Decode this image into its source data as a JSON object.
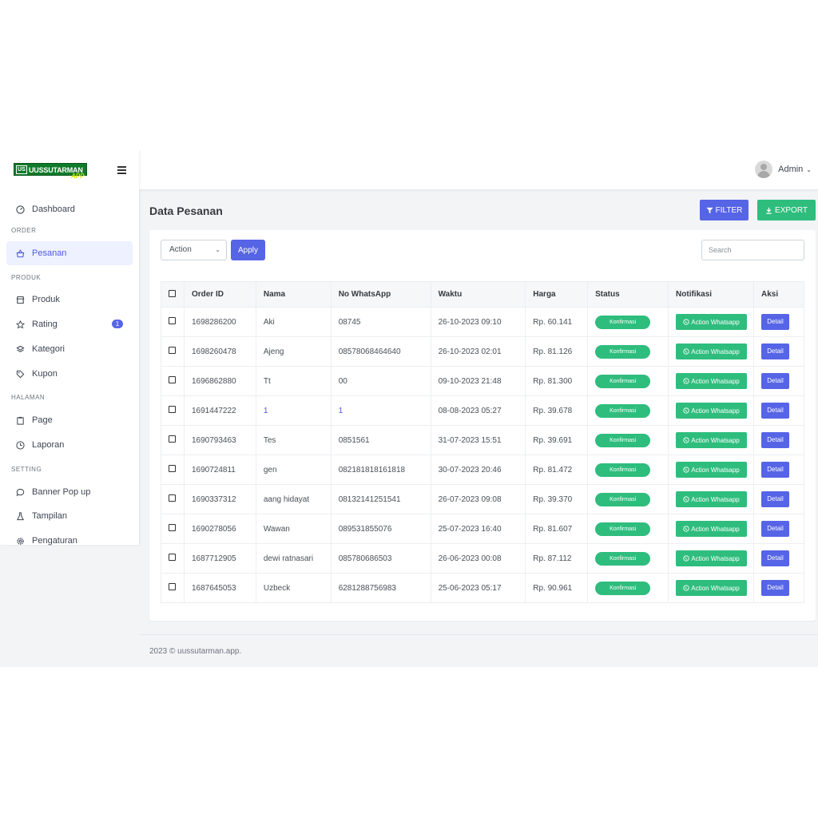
{
  "brand": {
    "logo_mark": "US",
    "logo_text": "UUSSUTARMAN",
    "logo_suffix": "APP"
  },
  "header": {
    "user_name": "Admin"
  },
  "sidebar": {
    "dashboard": "Dashboard",
    "section_order": "ORDER",
    "pesanan": "Pesanan",
    "section_produk": "PRODUK",
    "produk": "Produk",
    "rating": "Rating",
    "rating_badge": "1",
    "kategori": "Kategori",
    "kupon": "Kupon",
    "section_halaman": "HALAMAN",
    "page": "Page",
    "laporan": "Laporan",
    "section_setting": "SETTING",
    "banner": "Banner Pop up",
    "tampilan": "Tampilan",
    "pengaturan": "Pengaturan"
  },
  "main": {
    "title": "Data Pesanan",
    "filter_label": "FILTER",
    "export_label": "EXPORT",
    "action_select": "Action",
    "apply_label": "Apply",
    "search_placeholder": "Search"
  },
  "table": {
    "columns": [
      "Order ID",
      "Nama",
      "No WhatsApp",
      "Waktu",
      "Harga",
      "Status",
      "Notifikasi",
      "Aksi"
    ],
    "rows": [
      {
        "id": "1698286200",
        "nama": "Aki",
        "wa": "08745",
        "waktu": "26-10-2023 09:10",
        "harga": "Rp. 60.141"
      },
      {
        "id": "1698260478",
        "nama": "Ajeng",
        "wa": "08578068464640",
        "waktu": "26-10-2023 02:01",
        "harga": "Rp. 81.126"
      },
      {
        "id": "1696862880",
        "nama": "Tt",
        "wa": "00",
        "waktu": "09-10-2023 21:48",
        "harga": "Rp. 81.300"
      },
      {
        "id": "1691447222",
        "nama": "1",
        "wa": "1",
        "waktu": "08-08-2023 05:27",
        "harga": "Rp. 39.678"
      },
      {
        "id": "1690793463",
        "nama": "Tes",
        "wa": "0851561",
        "waktu": "31-07-2023 15:51",
        "harga": "Rp. 39.691"
      },
      {
        "id": "1690724811",
        "nama": "gen",
        "wa": "082181818161818",
        "waktu": "30-07-2023 20:46",
        "harga": "Rp. 81.472"
      },
      {
        "id": "1690337312",
        "nama": "aang hidayat",
        "wa": "08132141251541",
        "waktu": "26-07-2023 09:08",
        "harga": "Rp. 39.370"
      },
      {
        "id": "1690278056",
        "nama": "Wawan",
        "wa": "089531855076",
        "waktu": "25-07-2023 16:40",
        "harga": "Rp. 81.607"
      },
      {
        "id": "1687712905",
        "nama": "dewi ratnasari",
        "wa": "085780686503",
        "waktu": "26-06-2023 00:08",
        "harga": "Rp. 87.112"
      },
      {
        "id": "1687645053",
        "nama": "Uzbeck",
        "wa": "6281288756983",
        "waktu": "25-06-2023 05:17",
        "harga": "Rp. 90.961"
      }
    ],
    "status_label": "Konfirmasi",
    "notif_label": "Action Whatsapp",
    "detail_label": "Detail"
  },
  "footer": {
    "text": "2023 © uussutarman.app."
  },
  "colors": {
    "primary": "#5664e6",
    "success": "#2ebd7d",
    "brand_green": "#0f7a2a"
  }
}
